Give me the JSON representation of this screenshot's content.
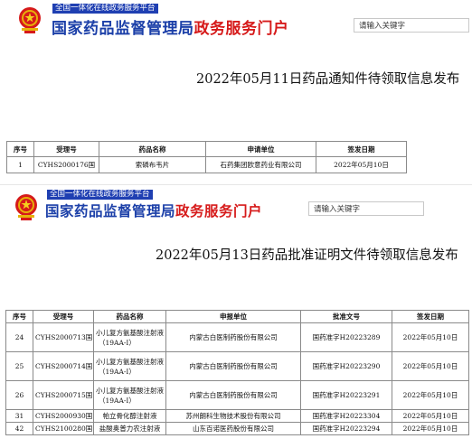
{
  "top": {
    "tagline": "全国一体化在线政务服务平台",
    "site_title_blue": "国家药品监督管理局",
    "site_title_red": "政务服务门户",
    "search_placeholder": "请输入关键字",
    "doc_title": "2022年05月11日药品通知件待领取信息发布",
    "table_headers": [
      "序号",
      "受理号",
      "药品名称",
      "申请单位",
      "签发日期"
    ],
    "rows": [
      {
        "no": "1",
        "id": "CYHS2000176国",
        "drug": "索磷布韦片",
        "applicant": "石药集团欧意药业有限公司",
        "date": "2022年05月10日"
      }
    ]
  },
  "bottom": {
    "tagline": "全国一体化在线政务服务平台",
    "site_title_blue": "国家药品监督管理局",
    "site_title_red": "政务服务门户",
    "search_placeholder": "请输入关键字",
    "doc_title": "2022年05月13日药品批准证明文件待领取信息发布",
    "table_headers": [
      "序号",
      "受理号",
      "药品名称",
      "申报单位",
      "批准文号",
      "签发日期"
    ],
    "rows": [
      {
        "no": "24",
        "id": "CYHS2000713国",
        "drug_l1": "小儿复方氨基酸注射液",
        "drug_l2": "（19AA-Ⅰ）",
        "applicant": "内蒙古白医制药股份有限公司",
        "approval": "国药准字H20223289",
        "date": "2022年05月10日"
      },
      {
        "no": "25",
        "id": "CYHS2000714国",
        "drug_l1": "小儿复方氨基酸注射液",
        "drug_l2": "（19AA-Ⅰ）",
        "applicant": "内蒙古白医制药股份有限公司",
        "approval": "国药准字H20223290",
        "date": "2022年05月10日"
      },
      {
        "no": "26",
        "id": "CYHS2000715国",
        "drug_l1": "小儿复方氨基酸注射液",
        "drug_l2": "（19AA-Ⅰ）",
        "applicant": "内蒙古白医制药股份有限公司",
        "approval": "国药准字H20223291",
        "date": "2022年05月10日"
      },
      {
        "no": "31",
        "id": "CYHS2000930国",
        "drug_l1": "帕立骨化醇注射液",
        "drug_l2": "",
        "applicant": "苏州朗科生物技术股份有限公司",
        "approval": "国药准字H20223304",
        "date": "2022年05月10日"
      },
      {
        "no": "42",
        "id": "CYHS2100280国",
        "drug_l1": "盐酸奥普力农注射液",
        "drug_l2": "",
        "applicant": "山东百诺医药股份有限公司",
        "approval": "国药准字H20223294",
        "date": "2022年05月10日"
      }
    ]
  },
  "colors": {
    "brand_blue": "#1b3fa8",
    "brand_red": "#d61a1a",
    "tagline_bg": "#1f3fb2"
  },
  "icons": {
    "emblem": "national-emblem-icon"
  }
}
